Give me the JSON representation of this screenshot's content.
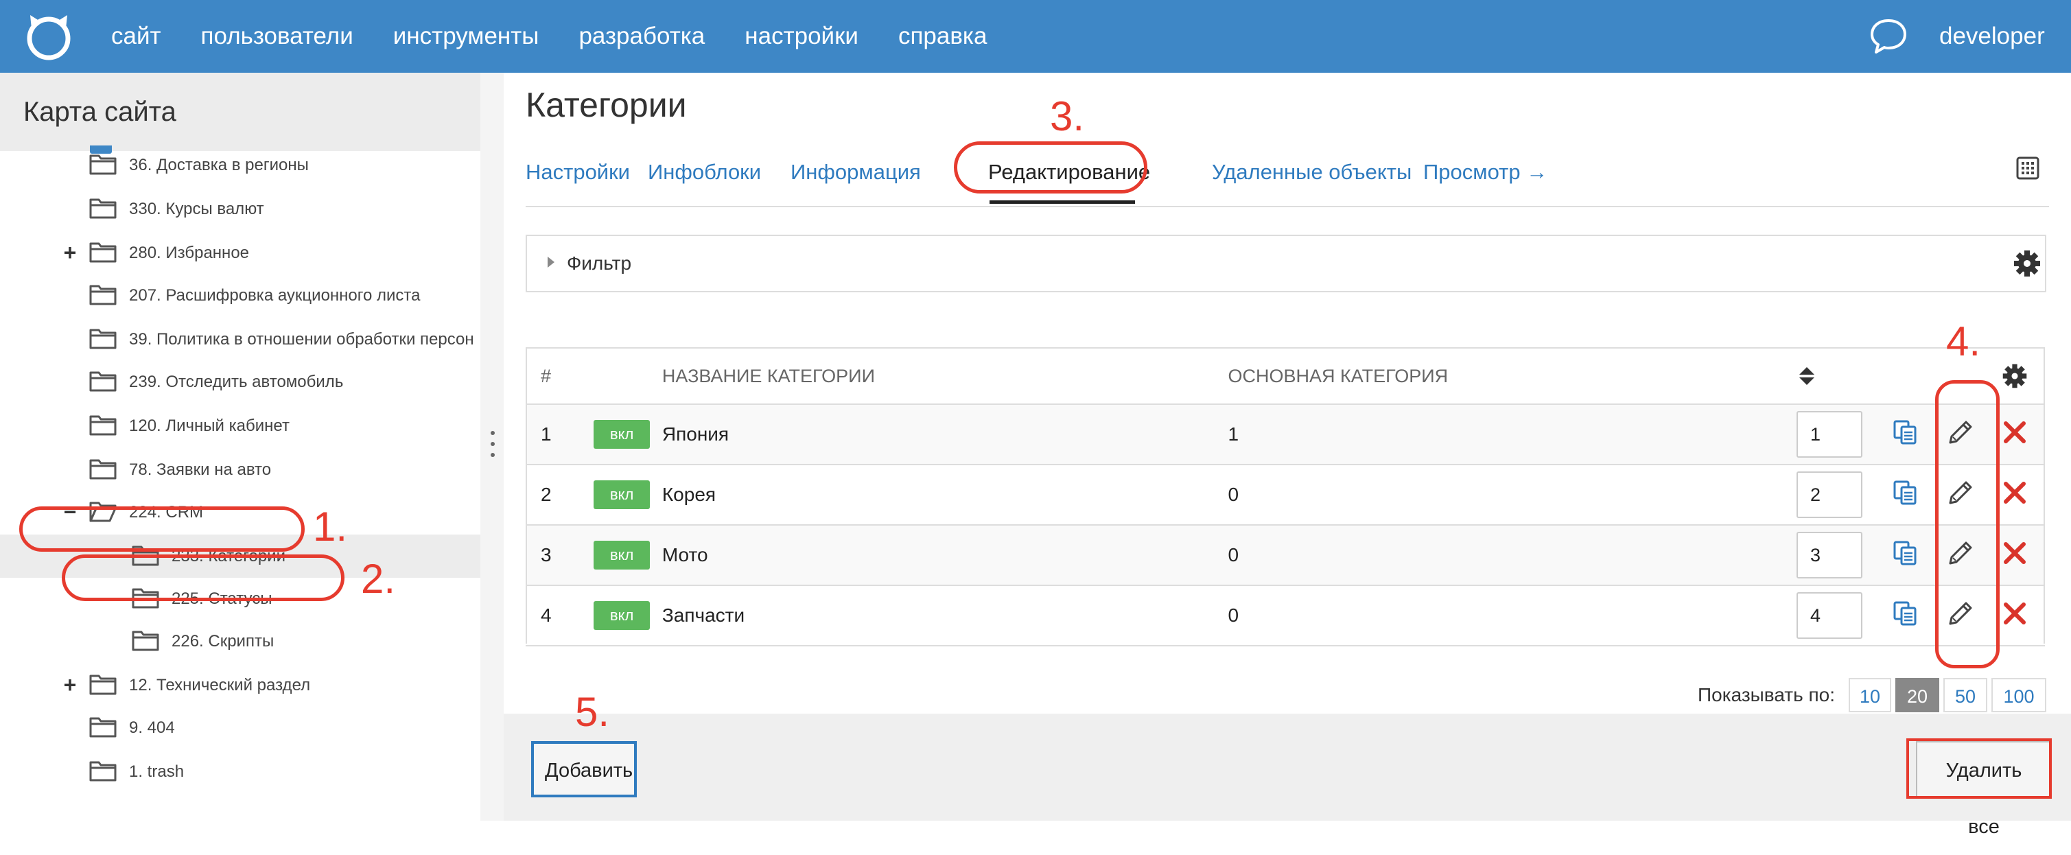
{
  "topbar": {
    "nav": [
      "сайт",
      "пользователи",
      "инструменты",
      "разработка",
      "настройки",
      "справка"
    ],
    "username": "developer"
  },
  "sidebar": {
    "title": "Карта сайта",
    "items": [
      {
        "label": "36. Доставка в регионы",
        "toggle": ""
      },
      {
        "label": "330. Курсы валют",
        "toggle": ""
      },
      {
        "label": "280. Избранное",
        "toggle": "+"
      },
      {
        "label": "207. Расшифровка аукционного листа",
        "toggle": ""
      },
      {
        "label": "39. Политика в отношении обработки персон",
        "toggle": ""
      },
      {
        "label": "239. Отследить автомобиль",
        "toggle": ""
      },
      {
        "label": "120. Личный кабинет",
        "toggle": ""
      },
      {
        "label": "78. Заявки на авто",
        "toggle": ""
      },
      {
        "label": "224. CRM",
        "toggle": "−"
      },
      {
        "label": "233. Категории",
        "toggle": ""
      },
      {
        "label": "225. Статусы",
        "toggle": ""
      },
      {
        "label": "226. Скрипты",
        "toggle": ""
      },
      {
        "label": "12. Технический раздел",
        "toggle": "+"
      },
      {
        "label": "9. 404",
        "toggle": ""
      },
      {
        "label": "1. trash",
        "toggle": ""
      }
    ]
  },
  "main": {
    "title": "Категории",
    "tabs": [
      "Настройки",
      "Инфоблоки",
      "Информация",
      "Редактирование",
      "Удаленные объекты",
      "Просмотр →"
    ],
    "filter_label": "Фильтр",
    "table": {
      "headers": {
        "num": "#",
        "name": "НАЗВАНИЕ КАТЕГОРИИ",
        "parent": "ОСНОВНАЯ КАТЕГОРИЯ"
      },
      "rows": [
        {
          "num": "1",
          "badge": "вкл",
          "name": "Япония",
          "parent": "1",
          "sort": "1"
        },
        {
          "num": "2",
          "badge": "вкл",
          "name": "Корея",
          "parent": "0",
          "sort": "2"
        },
        {
          "num": "3",
          "badge": "вкл",
          "name": "Мото",
          "parent": "0",
          "sort": "3"
        },
        {
          "num": "4",
          "badge": "вкл",
          "name": "Запчасти",
          "parent": "0",
          "sort": "4"
        }
      ]
    },
    "pager": {
      "label": "Показывать по:",
      "sizes": [
        "10",
        "20",
        "50",
        "100"
      ],
      "active": "20"
    },
    "add_button": "Добавить",
    "delete_all_button": "Удалить все"
  },
  "annotations": [
    "1.",
    "2.",
    "3.",
    "4.",
    "5."
  ],
  "colors": {
    "topbar": "#3e87c6",
    "link": "#2f7bbf",
    "badge": "#5cb85c",
    "annotation": "#e63b2e",
    "delete": "#d9342b"
  }
}
